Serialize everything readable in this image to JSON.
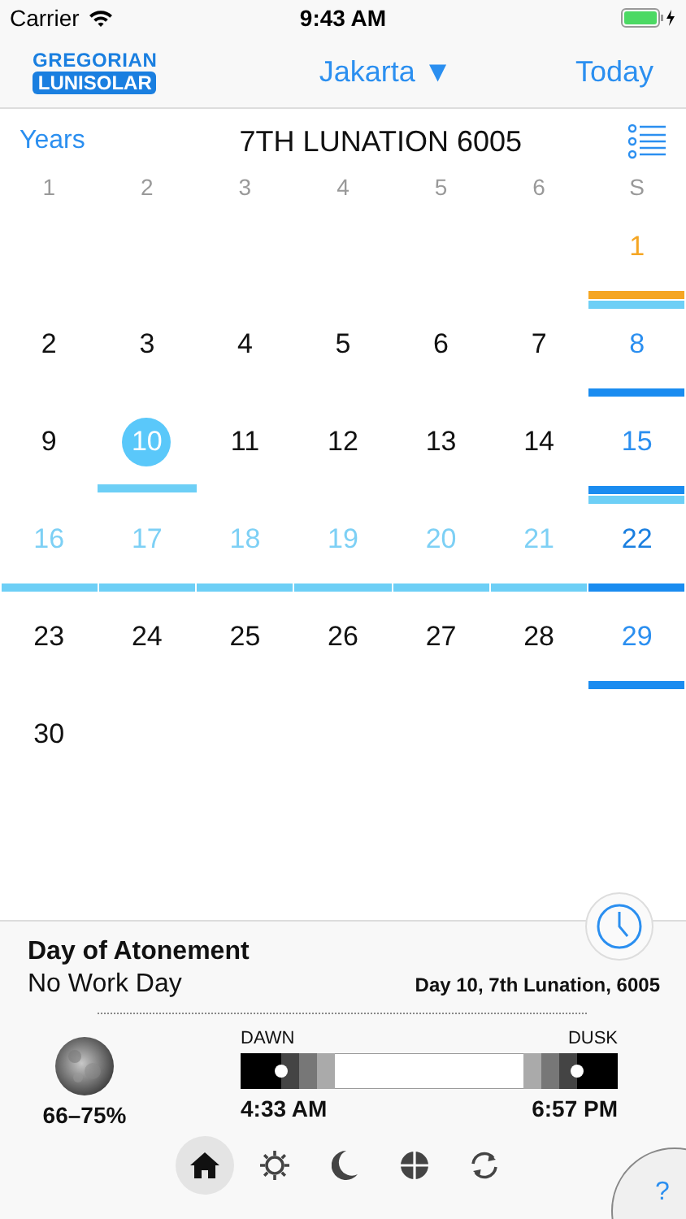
{
  "status_bar": {
    "carrier": "Carrier",
    "time": "9:43 AM"
  },
  "nav": {
    "logo_top": "GREGORIAN",
    "logo_bottom": "LUNISOLAR",
    "location": "Jakarta ▼",
    "today": "Today"
  },
  "header": {
    "back": "Years",
    "title": "7TH LUNATION 6005"
  },
  "weekdays": [
    "1",
    "2",
    "3",
    "4",
    "5",
    "6",
    "S"
  ],
  "weeks": [
    [
      {
        "label": "1",
        "color": "#f5a623",
        "selected": false,
        "bars": [
          {
            "color": "#f5a623"
          },
          {
            "color": "#6dcff6"
          }
        ]
      }
    ],
    [
      {
        "label": "2",
        "color": "#111111",
        "selected": false
      },
      {
        "label": "3",
        "color": "#111111",
        "selected": false
      },
      {
        "label": "4",
        "color": "#111111",
        "selected": false
      },
      {
        "label": "5",
        "color": "#111111",
        "selected": false
      },
      {
        "label": "6",
        "color": "#111111",
        "selected": false
      },
      {
        "label": "7",
        "color": "#111111",
        "selected": false
      },
      {
        "label": "8",
        "color": "#2b8ff0",
        "selected": false,
        "bars": [
          {
            "color": "#1a8cf0"
          }
        ]
      }
    ],
    [
      {
        "label": "9",
        "color": "#111111",
        "selected": false
      },
      {
        "label": "10",
        "selected": true,
        "bars": [
          {
            "color": "#6dcff6"
          }
        ]
      },
      {
        "label": "11",
        "color": "#111111",
        "selected": false
      },
      {
        "label": "12",
        "color": "#111111",
        "selected": false
      },
      {
        "label": "13",
        "color": "#111111",
        "selected": false
      },
      {
        "label": "14",
        "color": "#111111",
        "selected": false
      },
      {
        "label": "15",
        "color": "#2b8ff0",
        "selected": false,
        "bars": [
          {
            "color": "#1a8cf0"
          },
          {
            "color": "#6dcff6"
          }
        ]
      }
    ],
    [
      {
        "label": "16",
        "color": "#7dd0f5",
        "selected": false,
        "bars": [
          {
            "color": "#6dcff6"
          }
        ]
      },
      {
        "label": "17",
        "color": "#7dd0f5",
        "selected": false,
        "bars": [
          {
            "color": "#6dcff6"
          }
        ]
      },
      {
        "label": "18",
        "color": "#7dd0f5",
        "selected": false,
        "bars": [
          {
            "color": "#6dcff6"
          }
        ]
      },
      {
        "label": "19",
        "color": "#7dd0f5",
        "selected": false,
        "bars": [
          {
            "color": "#6dcff6"
          }
        ]
      },
      {
        "label": "20",
        "color": "#7dd0f5",
        "selected": false,
        "bars": [
          {
            "color": "#6dcff6"
          }
        ]
      },
      {
        "label": "21",
        "color": "#7dd0f5",
        "selected": false,
        "bars": [
          {
            "color": "#6dcff6"
          }
        ]
      },
      {
        "label": "22",
        "color": "#1a7fe0",
        "selected": false,
        "bars": [
          {
            "color": "#1a8cf0"
          }
        ]
      }
    ],
    [
      {
        "label": "23",
        "color": "#111111",
        "selected": false
      },
      {
        "label": "24",
        "color": "#111111",
        "selected": false
      },
      {
        "label": "25",
        "color": "#111111",
        "selected": false
      },
      {
        "label": "26",
        "color": "#111111",
        "selected": false
      },
      {
        "label": "27",
        "color": "#111111",
        "selected": false
      },
      {
        "label": "28",
        "color": "#111111",
        "selected": false
      },
      {
        "label": "29",
        "color": "#2b8ff0",
        "selected": false,
        "bars": [
          {
            "color": "#1a8cf0"
          }
        ]
      }
    ],
    [
      {
        "label": "30",
        "color": "#111111",
        "selected": false
      }
    ]
  ],
  "details": {
    "event": "Day of Atonement",
    "note": "No Work Day",
    "date": "Day 10, 7th Lunation, 6005",
    "moon_phase": "66–75%",
    "dawn_label": "DAWN",
    "dusk_label": "DUSK",
    "dawn_time": "4:33 AM",
    "dusk_time": "6:57 PM"
  },
  "tabs": [
    {
      "kind": "home",
      "selected": true
    },
    {
      "kind": "sun",
      "selected": false
    },
    {
      "kind": "moon",
      "selected": false
    },
    {
      "kind": "globe",
      "selected": false
    },
    {
      "kind": "sync",
      "selected": false
    }
  ],
  "help": "?"
}
